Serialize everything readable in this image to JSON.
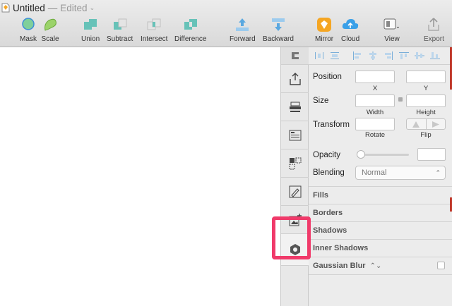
{
  "window": {
    "title": "Untitled",
    "separator": "—",
    "status": "Edited",
    "status_chevron": "⌄"
  },
  "toolbar": {
    "items": [
      {
        "label": "Mask",
        "icon": "mask-icon"
      },
      {
        "label": "Scale",
        "icon": "scale-icon"
      },
      {
        "label": "Union",
        "icon": "union-icon"
      },
      {
        "label": "Subtract",
        "icon": "subtract-icon"
      },
      {
        "label": "Intersect",
        "icon": "intersect-icon"
      },
      {
        "label": "Difference",
        "icon": "difference-icon"
      },
      {
        "label": "Forward",
        "icon": "forward-icon"
      },
      {
        "label": "Backward",
        "icon": "backward-icon"
      },
      {
        "label": "Mirror",
        "icon": "mirror-icon"
      },
      {
        "label": "Cloud",
        "icon": "cloud-icon"
      },
      {
        "label": "View",
        "icon": "view-icon"
      },
      {
        "label": "Export",
        "icon": "export-icon"
      }
    ]
  },
  "inspector": {
    "position_label": "Position",
    "x_label": "X",
    "y_label": "Y",
    "size_label": "Size",
    "width_label": "Width",
    "height_label": "Height",
    "transform_label": "Transform",
    "rotate_label": "Rotate",
    "flip_label": "Flip",
    "opacity_label": "Opacity",
    "blending_label": "Blending",
    "blending_value": "Normal",
    "sections": {
      "fills": "Fills",
      "borders": "Borders",
      "shadows": "Shadows",
      "inner_shadows": "Inner Shadows",
      "gaussian_blur": "Gaussian Blur",
      "gaussian_sorter": "⌃⌄"
    }
  },
  "tabs": [
    {
      "icon": "share-icon"
    },
    {
      "icon": "print-icon"
    },
    {
      "icon": "layout-icon"
    },
    {
      "icon": "symbols-icon"
    },
    {
      "icon": "pen-icon"
    },
    {
      "icon": "image-add-icon"
    },
    {
      "icon": "plugin-hex-icon"
    }
  ],
  "colors": {
    "highlight": "#f03a6a",
    "mirror": "#f5a623",
    "cloud": "#3aa0e8",
    "shape_green": "#7fcf9a",
    "shape_teal": "#67c2b8"
  }
}
